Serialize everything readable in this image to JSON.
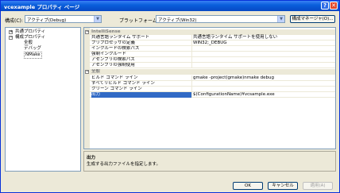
{
  "window": {
    "title": "vcexample プロパティ ページ",
    "help_glyph": "?",
    "close_glyph": "✕"
  },
  "toolbar": {
    "config_label": "構成(C):",
    "config_value": "アクティブ(Debug)",
    "platform_label": "プラットフォーム(P):",
    "platform_value": "アクティブ(Win32)",
    "config_manager": "構成マネージャ(O)..."
  },
  "tree": {
    "items": [
      {
        "label": "共通プロパティ",
        "expander": "+"
      },
      {
        "label": "構成プロパティ",
        "expander": "−"
      },
      {
        "label": "全般"
      },
      {
        "label": "デバッグ"
      },
      {
        "label": "NMake"
      }
    ]
  },
  "grid": {
    "rows": [
      {
        "type": "category",
        "name": "IntelliSense",
        "expander": "−"
      },
      {
        "name": "共通言語ランタイム サポート",
        "value": "共通言語ランタイム サポートを使用しない"
      },
      {
        "name": "プリプロセッサの定義",
        "value": "WIN32;_DEBUG"
      },
      {
        "name": "インクルードの検索パス",
        "value": ""
      },
      {
        "name": "強制インクルード",
        "value": ""
      },
      {
        "name": "アセンブリの検索パス",
        "value": ""
      },
      {
        "name": "アセンブリの強制使用",
        "value": ""
      },
      {
        "type": "category",
        "name": "全般",
        "expander": "−"
      },
      {
        "name": "ビルド コマンド ライン",
        "value": "gmake -project(gmake)nmake debug"
      },
      {
        "name": "すべてリビルド コマンド ライン",
        "value": ""
      },
      {
        "name": "クリーン コマンド ライン",
        "value": ""
      },
      {
        "name": "出力",
        "value": "$(ConfigurationName)¥vcsample.exe",
        "selected": true
      }
    ]
  },
  "description": {
    "title": "出力",
    "text": "生成する出力ファイルを指定します。"
  },
  "buttons": {
    "ok": "OK",
    "cancel": "キャンセル",
    "apply": "適用(A)"
  },
  "colors": {
    "title_bar": "#0a5fdc",
    "selection": "#316ac5",
    "dialog_bg": "#ece9d8"
  }
}
